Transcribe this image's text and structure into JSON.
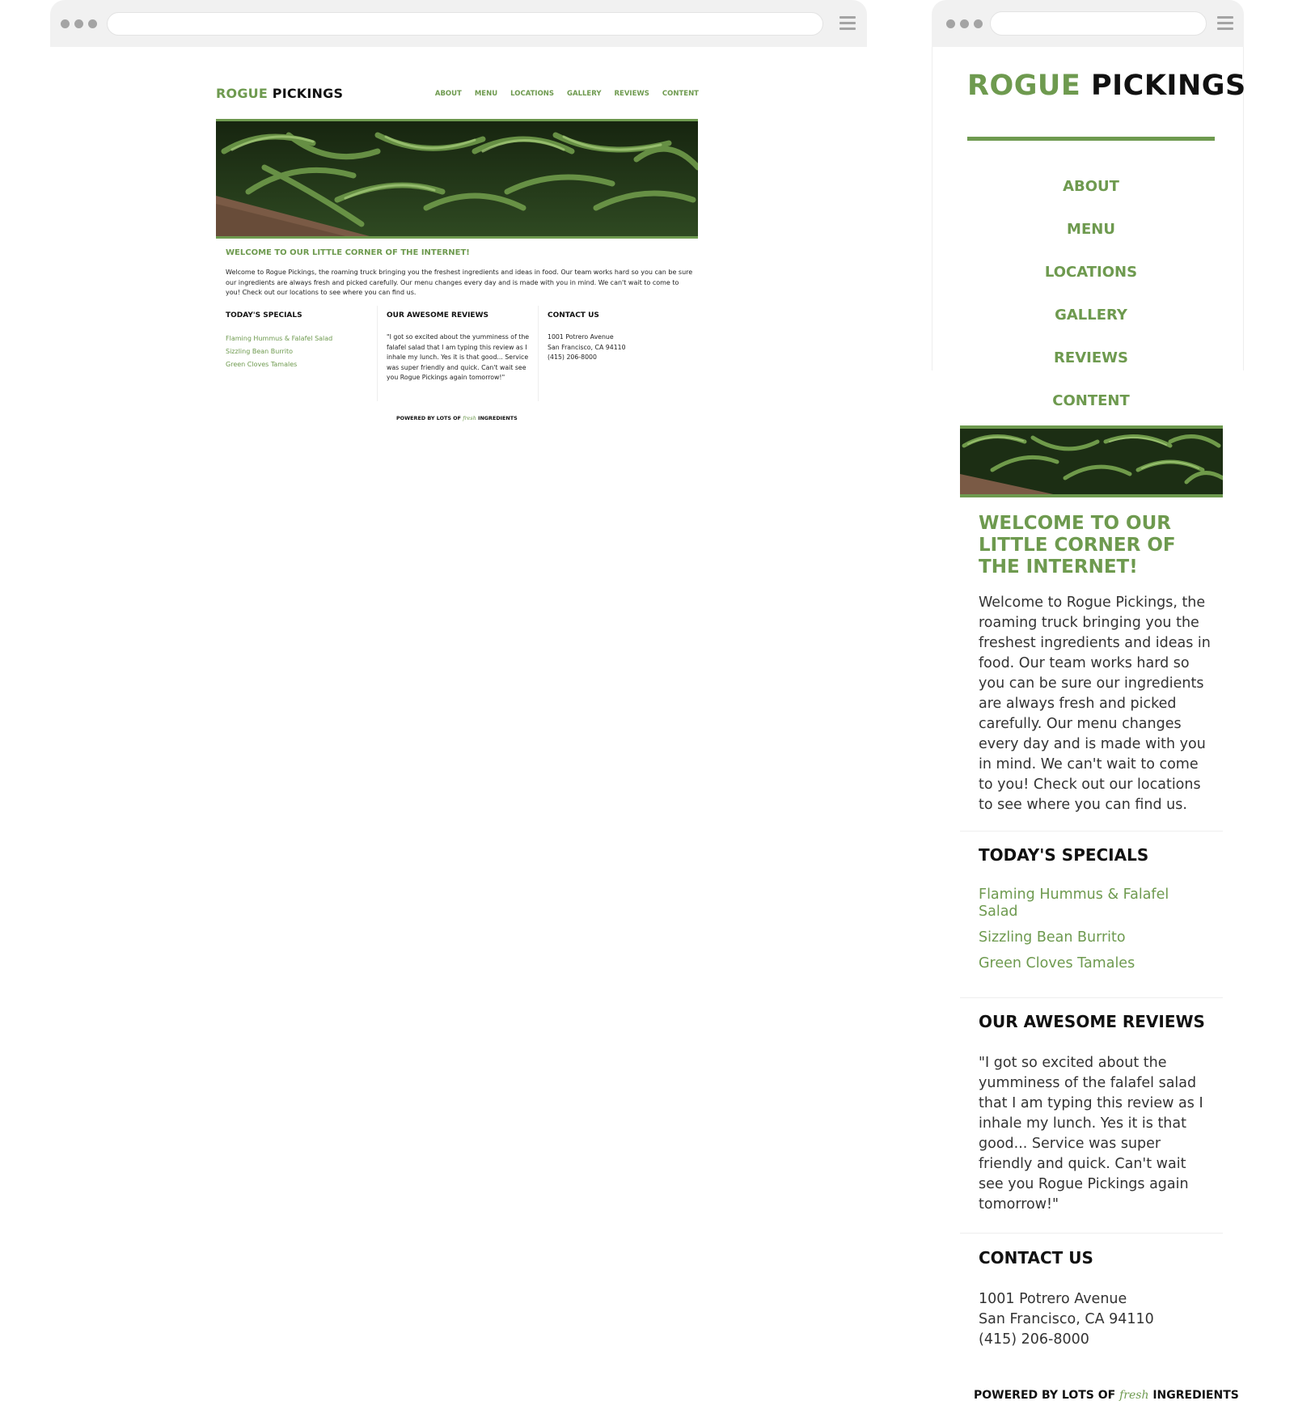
{
  "brand": {
    "first": "ROGUE",
    "second": "PICKINGS"
  },
  "nav": [
    "ABOUT",
    "MENU",
    "LOCATIONS",
    "GALLERY",
    "REVIEWS",
    "CONTENT"
  ],
  "welcome": {
    "title": "WELCOME TO OUR LITTLE CORNER OF THE INTERNET!",
    "body": "Welcome to Rogue Pickings, the roaming truck bringing you the freshest ingredients and ideas in food. Our team works hard so you can be sure our ingredients are always fresh and picked carefully. Our menu changes every day and is made with you in mind. We can't wait to come to you! Check out our locations to see where you can find us."
  },
  "specials": {
    "title": "TODAY'S SPECIALS",
    "items": [
      "Flaming Hummus & Falafel Salad",
      "Sizzling Bean Burrito",
      "Green Cloves Tamales"
    ]
  },
  "reviews": {
    "title": "OUR AWESOME REVIEWS",
    "text": "\"I got so excited about the yumminess of the falafel salad that I am typing this review as I inhale my lunch. Yes it is that good... Service was super friendly and quick. Can't wait see you Rogue Pickings again tomorrow!\""
  },
  "contact": {
    "title": "CONTACT US",
    "lines": [
      "1001 Potrero Avenue",
      "San Francisco, CA 94110",
      "(415) 206-8000"
    ]
  },
  "footer": {
    "before": "POWERED BY LOTS OF",
    "script_word": "fresh",
    "after": "INGREDIENTS"
  },
  "colors": {
    "accent": "#6e9a4f",
    "text": "#111111",
    "chrome": "#f1f1f1"
  },
  "icons": [
    "window-dots-icon",
    "menu-icon",
    "green-beans-image"
  ]
}
